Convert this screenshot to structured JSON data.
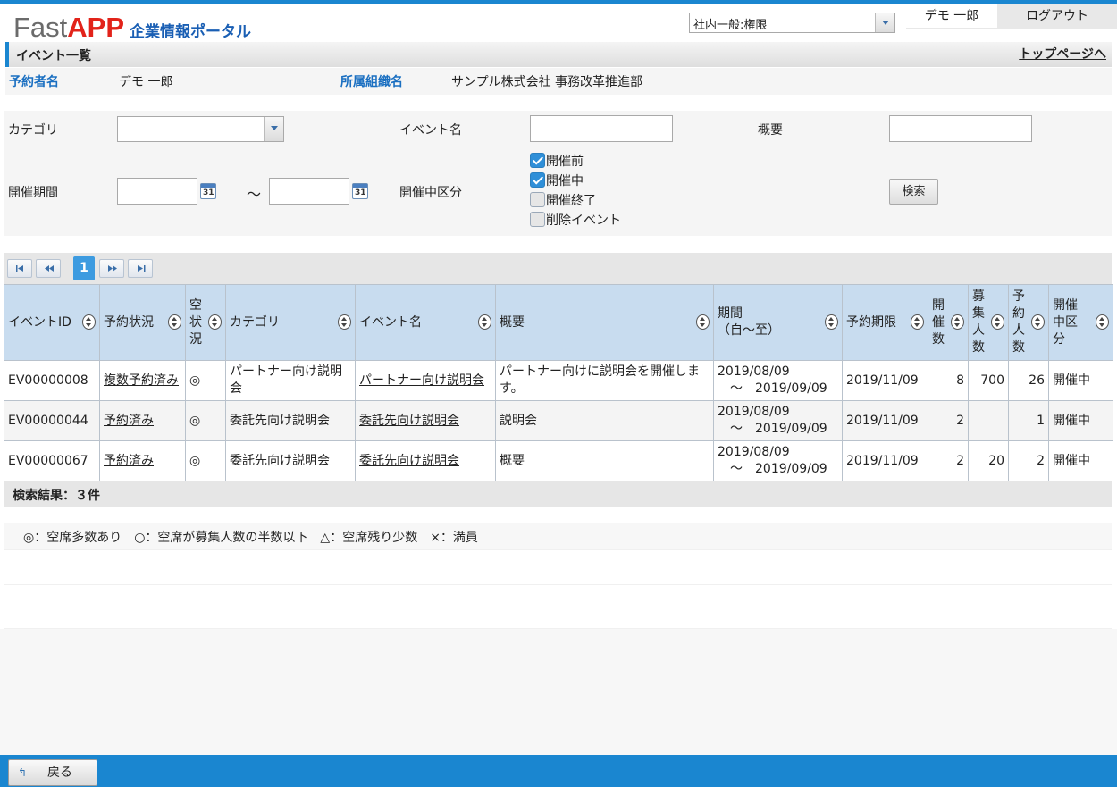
{
  "header": {
    "logo_fast": "Fast",
    "logo_app": "APP",
    "logo_sub": "企業情報ポータル",
    "role_select": "社内一般:権限",
    "user_name": "デモ 一郎",
    "logout": "ログアウト"
  },
  "page": {
    "title": "イベント一覧",
    "top_link": "トップページへ"
  },
  "info": {
    "reserver_label": "予約者名",
    "reserver_value": "デモ 一郎",
    "org_label": "所属組織名",
    "org_value": "サンプル株式会社 事務改革推進部"
  },
  "search": {
    "category_label": "カテゴリ",
    "category_value": "",
    "event_name_label": "イベント名",
    "event_name_value": "",
    "summary_label": "概要",
    "summary_value": "",
    "period_label": "開催期間",
    "period_from": "",
    "period_to": "",
    "tilde": "～",
    "calendar_day": "31",
    "status_label": "開催中区分",
    "status_options": [
      {
        "label": "開催前",
        "checked": true
      },
      {
        "label": "開催中",
        "checked": true
      },
      {
        "label": "開催終了",
        "checked": false
      },
      {
        "label": "削除イベント",
        "checked": false
      }
    ],
    "search_button": "検索"
  },
  "pager": {
    "current_page": "1"
  },
  "table": {
    "headers": {
      "event_id": "イベントID",
      "reserve_status": "予約状況",
      "vacancy": "空\n状\n況",
      "category": "カテゴリ",
      "event_name": "イベント名",
      "summary": "概要",
      "period": "期間\n（自～至）",
      "deadline": "予約期限",
      "count": "開\n催\n数",
      "capacity": "募\n集\n人\n数",
      "reserved": "予\n約\n人\n数",
      "status": "開催\n中区\n分"
    },
    "rows": [
      {
        "event_id": "EV00000008",
        "reserve_status": "複数予約済み",
        "vacancy": "◎",
        "category": "パートナー向け説明会",
        "event_name": "パートナー向け説明会",
        "summary": "パートナー向けに説明会を開催します。",
        "period_from": "2019/08/09",
        "period_to": "～　2019/09/09",
        "deadline": "2019/11/09",
        "count": "8",
        "capacity": "700",
        "reserved": "26",
        "status": "開催中"
      },
      {
        "event_id": "EV00000044",
        "reserve_status": "予約済み",
        "vacancy": "◎",
        "category": "委託先向け説明会",
        "event_name": "委託先向け説明会",
        "summary": "説明会",
        "period_from": "2019/08/09",
        "period_to": "～　2019/09/09",
        "deadline": "2019/11/09",
        "count": "2",
        "capacity": "",
        "reserved": "1",
        "status": "開催中"
      },
      {
        "event_id": "EV00000067",
        "reserve_status": "予約済み",
        "vacancy": "◎",
        "category": "委託先向け説明会",
        "event_name": "委託先向け説明会",
        "summary": "概要",
        "period_from": "2019/08/09",
        "period_to": "～　2019/09/09",
        "deadline": "2019/11/09",
        "count": "2",
        "capacity": "20",
        "reserved": "2",
        "status": "開催中"
      }
    ]
  },
  "result": "検索結果：３件",
  "legend": "◎：空席多数あり　○：空席が募集人数の半数以下　△：空席残り少数　×：満員",
  "footer": {
    "back_button": "戻る"
  },
  "colors": {
    "accent": "#1a86d0",
    "logo_red": "#e2231a",
    "label_blue": "#1a6fc1",
    "header_row": "#c8dcef"
  }
}
